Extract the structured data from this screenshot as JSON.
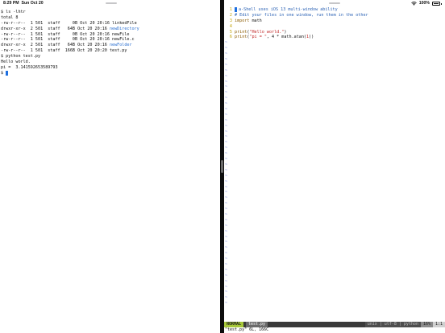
{
  "status_bar": {
    "time": "8:29 PM",
    "date": "Sun Oct 20",
    "battery": "100%",
    "battery_level": 1.0
  },
  "terminal": {
    "lines": [
      {
        "text": "$ ls -lhtr",
        "dir": ""
      },
      {
        "text": "total 8",
        "dir": ""
      },
      {
        "text": "-rw-r--r--  1 501  staff     0B Oct 20 20:16 ",
        "dir": "",
        "name": "linkedFile"
      },
      {
        "text": "drwxr-xr-x  2 501  staff   64B Oct 20 20:16 ",
        "dir": "newDirectory"
      },
      {
        "text": "-rw-r--r--  1 501  staff     0B Oct 20 20:16 ",
        "dir": "",
        "name": "newFile"
      },
      {
        "text": "-rw-r--r--  1 501  staff     0B Oct 20 20:16 ",
        "dir": "",
        "name": "newFile.c"
      },
      {
        "text": "drwxr-xr-x  2 501  staff   64B Oct 20 20:16 ",
        "dir": "newFolder"
      },
      {
        "text": "-rw-r--r--  1 501  staff  166B Oct 20 20:20 ",
        "dir": "",
        "name": "test.py"
      },
      {
        "text": "$ python test.py",
        "dir": ""
      },
      {
        "text": "Hello world.",
        "dir": ""
      },
      {
        "text": "pi =  3.141592653589793",
        "dir": ""
      }
    ],
    "prompt": "$"
  },
  "editor": {
    "lines": [
      {
        "num": "1",
        "segments": [
          {
            "cls": "comment",
            "text": "a-Shell uses iOS 13 multi-window ability"
          }
        ],
        "cursor": true
      },
      {
        "num": "2",
        "segments": [
          {
            "cls": "comment",
            "text": "# Edit your files in one window, run them in the other"
          }
        ]
      },
      {
        "num": "3",
        "segments": [
          {
            "cls": "kw",
            "text": "import"
          },
          {
            "cls": "",
            "text": " math"
          }
        ]
      },
      {
        "num": "4",
        "segments": []
      },
      {
        "num": "5",
        "segments": [
          {
            "cls": "kw",
            "text": "print"
          },
          {
            "cls": "",
            "text": "("
          },
          {
            "cls": "str",
            "text": "\"Hello world.\""
          },
          {
            "cls": "",
            "text": ")"
          }
        ]
      },
      {
        "num": "6",
        "segments": [
          {
            "cls": "kw",
            "text": "print"
          },
          {
            "cls": "",
            "text": "("
          },
          {
            "cls": "str",
            "text": "\"pi = \""
          },
          {
            "cls": "",
            "text": ", 4 * math.atan("
          },
          {
            "cls": "num",
            "text": "1"
          },
          {
            "cls": "",
            "text": "))"
          }
        ]
      }
    ],
    "tilde": "~",
    "tilde_count": 48
  },
  "statusline": {
    "mode": "NORMAL",
    "filename": "test.py",
    "info": "unix | utf-8 | python",
    "percent": "16%",
    "position": "1:1"
  },
  "cmdline": "\"test.py\" 6L, 166C",
  "colors": {
    "directory": "#2a6fcf",
    "cursor": "#1e6fe0",
    "mode_bg": "#a6c73a",
    "line_number": "#c0a000",
    "tilde": "#6b7dd6"
  }
}
